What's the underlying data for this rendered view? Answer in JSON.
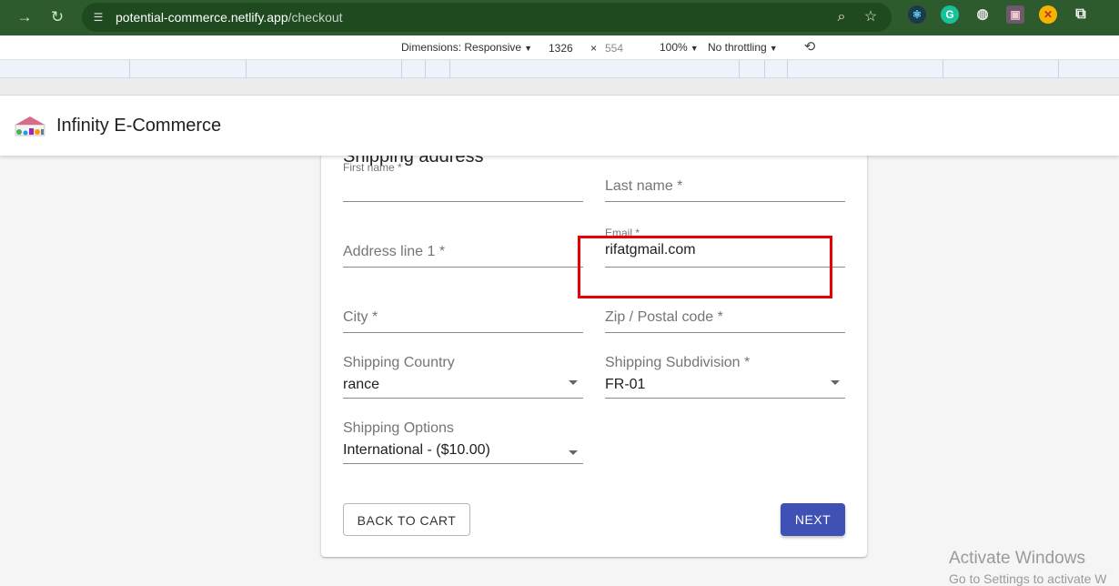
{
  "browser": {
    "url_host": "potential-commerce.netlify.app",
    "url_path": "/checkout"
  },
  "device_toolbar": {
    "dimensions_label": "Dimensions: Responsive",
    "width": "1326",
    "times": "×",
    "height": "554",
    "zoom": "100%",
    "throttling": "No throttling"
  },
  "header": {
    "title": "Infinity E-Commerce"
  },
  "form": {
    "title": "Shipping address",
    "first_name": {
      "label": "First name *",
      "value": ""
    },
    "last_name": {
      "label": "Last name *",
      "value": ""
    },
    "address_line1": {
      "label": "Address line 1 *",
      "value": ""
    },
    "email": {
      "label": "Email *",
      "value": "rifatgmail.com"
    },
    "city": {
      "label": "City *",
      "value": ""
    },
    "zip": {
      "label": "Zip / Postal code *",
      "value": ""
    },
    "shipping_country": {
      "label": "Shipping Country",
      "value": "rance"
    },
    "shipping_subdivision": {
      "label": "Shipping Subdivision *",
      "value": "FR-01"
    },
    "shipping_options": {
      "label": "Shipping Options",
      "value": "International - ($10.00)"
    },
    "back_button": "BACK TO CART",
    "next_button": "NEXT"
  },
  "watermark": {
    "line1": "Activate Windows",
    "line2": "Go to Settings to activate W"
  },
  "colors": {
    "browser_bar": "#2e5b2e",
    "primary": "#3f51b5",
    "highlight": "#e60000"
  }
}
